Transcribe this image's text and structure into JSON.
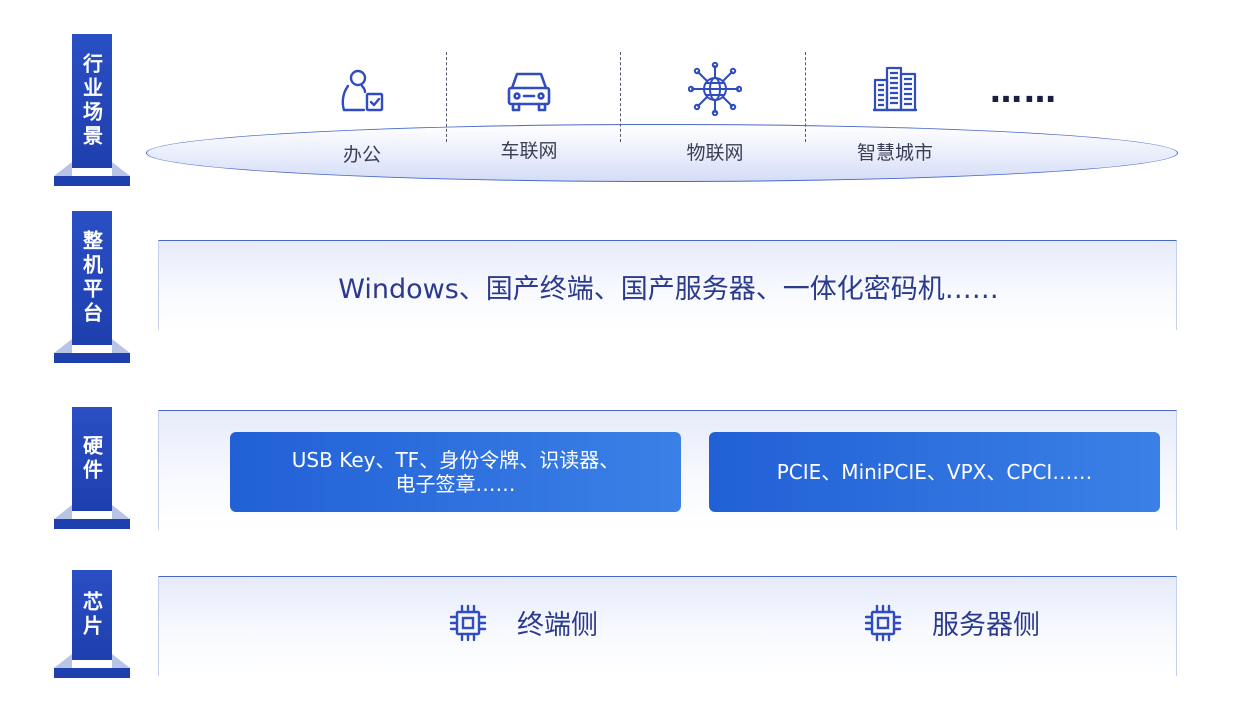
{
  "tiers": {
    "scenario": "行业场景",
    "platform": "整机平台",
    "hardware": "硬件",
    "chip": "芯片"
  },
  "scenarios": [
    {
      "label": "办公",
      "icon": "office-user-check-icon"
    },
    {
      "label": "车联网",
      "icon": "car-icon"
    },
    {
      "label": "物联网",
      "icon": "iot-globe-icon"
    },
    {
      "label": "智慧城市",
      "icon": "city-building-icon"
    }
  ],
  "scenario_more": "……",
  "platform": {
    "text": "Windows、国产终端、国产服务器、一体化密码机……"
  },
  "hardware": {
    "left_line1": "USB Key、TF、身份令牌、识读器、",
    "left_line2": "电子签章……",
    "right": "PCIE、MiniPCIE、VPX、CPCI……"
  },
  "chip": {
    "left_label": "终端侧",
    "right_label": "服务器侧",
    "icon": "chip-icon"
  },
  "colors": {
    "tier_label": "#1e3fae",
    "accent_text": "#2b3a8c",
    "hardware_box_start": "#2160d6",
    "hardware_box_end": "#3b80e6",
    "icon_blue": "#2f4cc0"
  }
}
